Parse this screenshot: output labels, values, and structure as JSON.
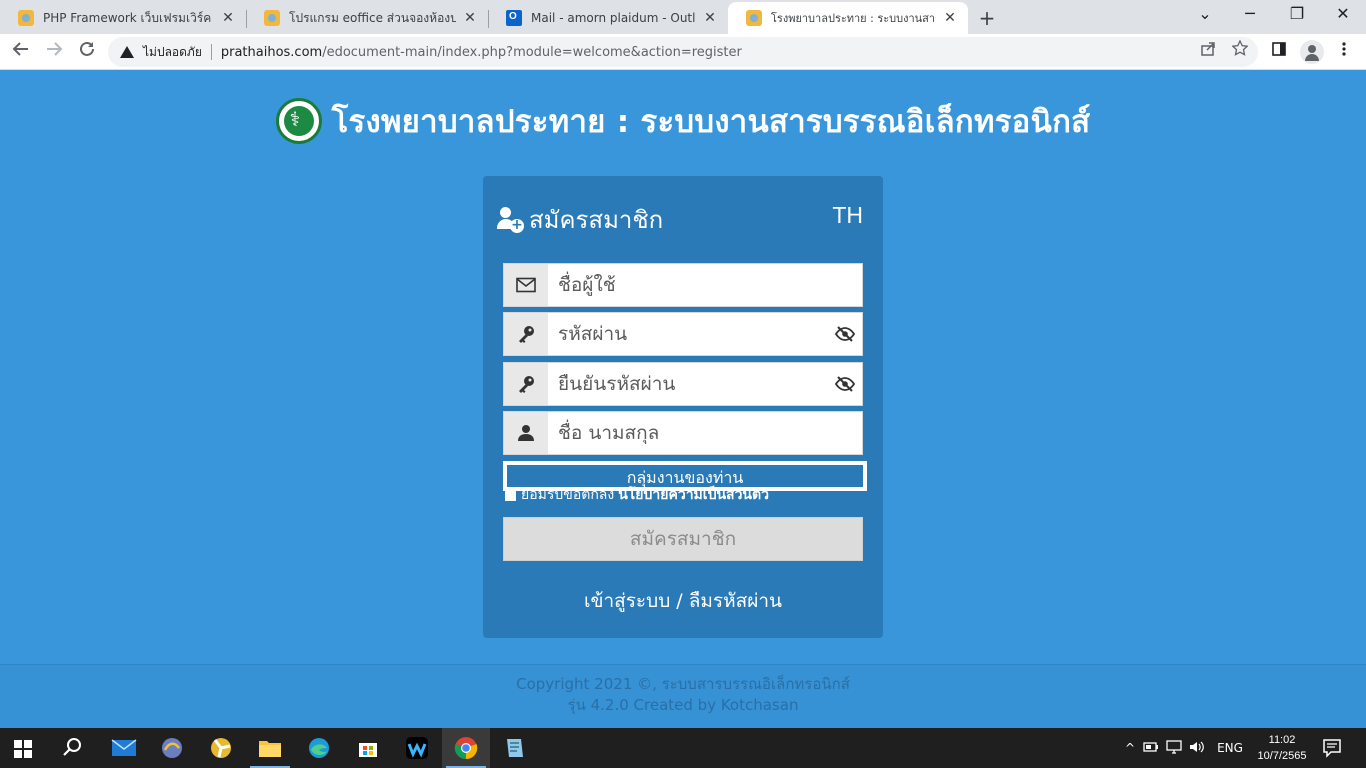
{
  "browser": {
    "tabs": [
      {
        "title": "PHP Framework เว็บเฟรมเวิร์ค โดยคชสาร",
        "close": "✕"
      },
      {
        "title": "โปรแกรม eoffice ส่วนจองห้องประชุม ระบบ",
        "close": "✕"
      },
      {
        "title": "Mail - amorn plaidum - Outlook",
        "close": "✕"
      },
      {
        "title": "โรงพยาบาลประทาย : ระบบงานสารบรรณ",
        "close": "✕"
      }
    ],
    "new_tab": "+",
    "window": {
      "minimize": "⌄",
      "restore": "─",
      "maximize": "❐",
      "close": "✕"
    },
    "security_label": "ไม่ปลอดภัย",
    "url_host": "prathaihos.com",
    "url_path": "/edocument-main/index.php?module=welcome&action=register"
  },
  "page": {
    "site_title": "โรงพยาบาลประทาย : ระบบงานสารบรรณอิเล็กทรอนิกส์",
    "panel_title": "สมัครสมาชิก",
    "language": "TH",
    "fields": {
      "username_placeholder": "ชื่อผู้ใช้",
      "password_placeholder": "รหัสผ่าน",
      "confirm_placeholder": "ยืนยันรหัสผ่าน",
      "name_placeholder": "ชื่อ นามสกุล"
    },
    "group_select": "กลุ่มงานของท่าน",
    "accept_text": "ยอมรับข้อตกลง",
    "accept_link": "นโยบายความเป็นส่วนตัว",
    "submit_label": "สมัครสมาชิก",
    "login_link": "เข้าสู่ระบบ",
    "link_separator": " / ",
    "forgot_link": "ลืมรหัสผ่าน",
    "footer_line1": "Copyright 2021 ©, ระบบสารบรรณอิเล็กทรอนิกส์",
    "footer_line2": "รุ่น 4.2.0 Created by Kotchasan"
  },
  "taskbar": {
    "language": "ENG",
    "time": "11:02",
    "date": "10/7/2565"
  }
}
